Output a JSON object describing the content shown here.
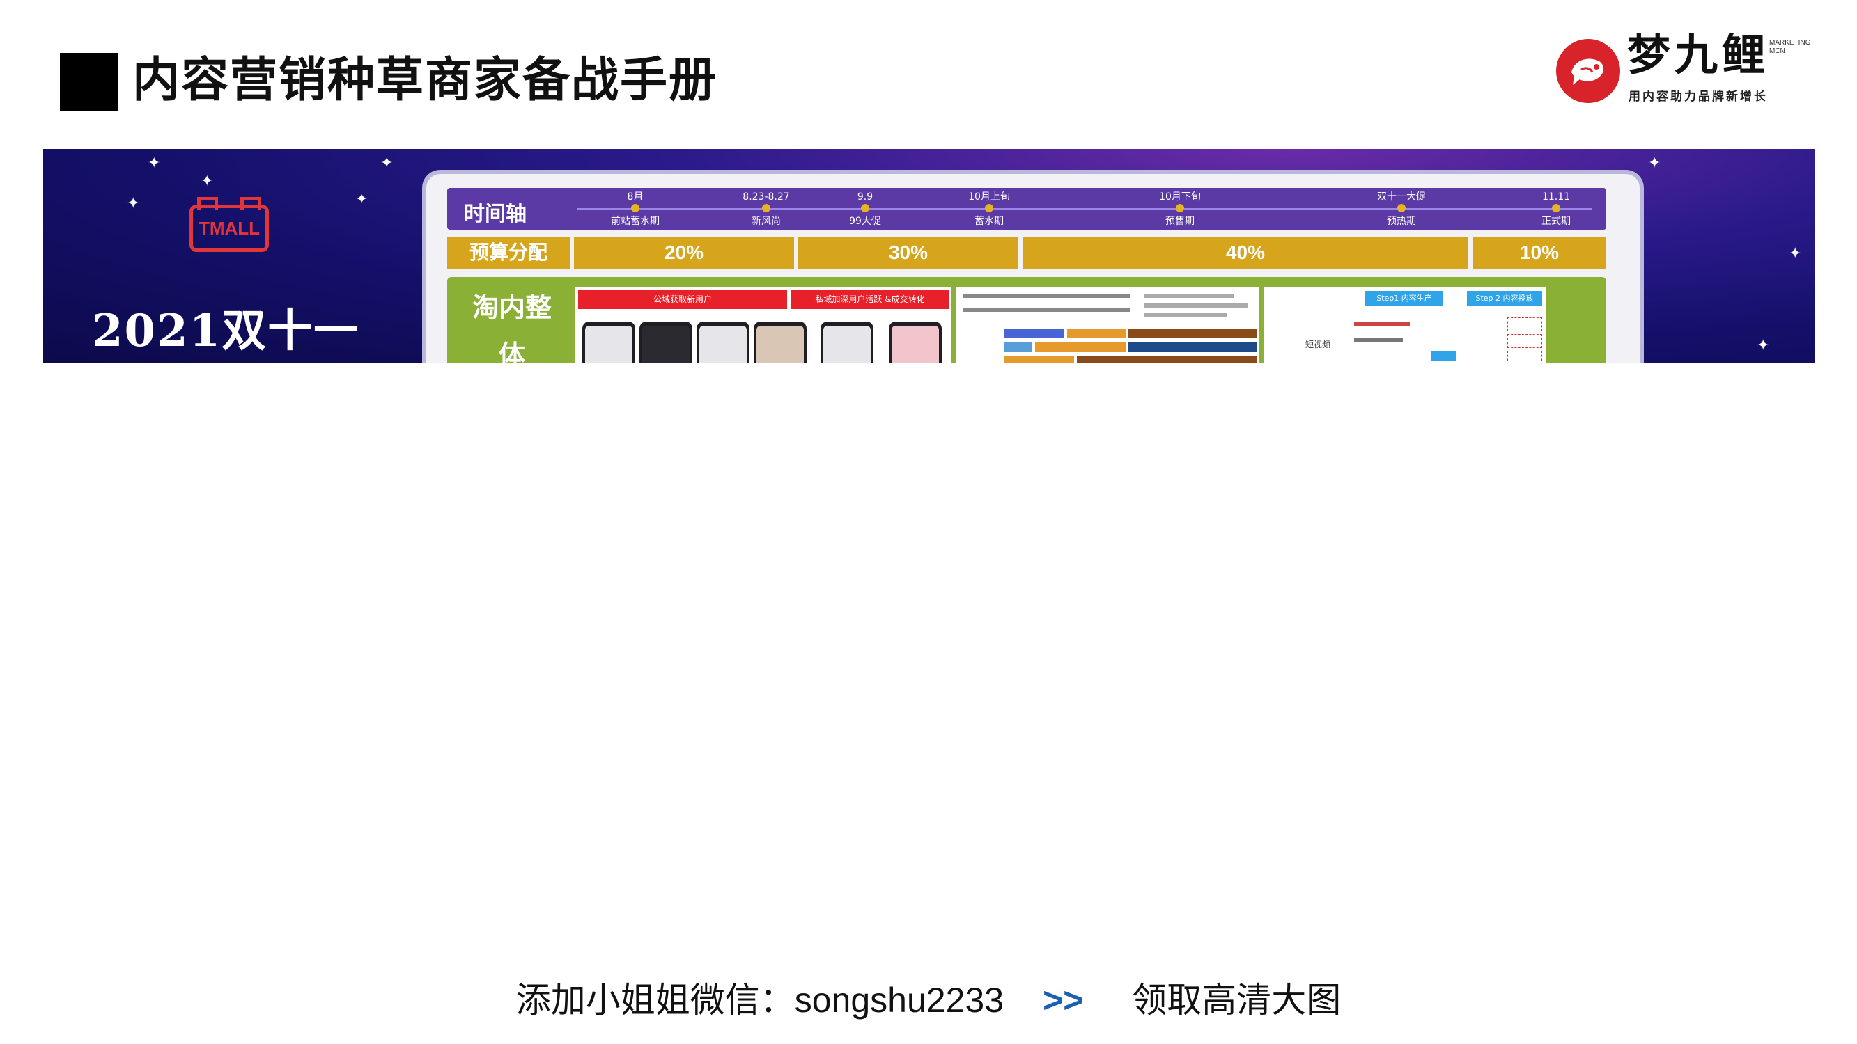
{
  "header": {
    "title": "内容营销种草商家备战手册"
  },
  "logo": {
    "name": "梦九鲤",
    "tagline": "用内容助力品牌新增长",
    "marketing_line1": "MARKETING",
    "marketing_line2": "MCN"
  },
  "banner": {
    "brand": "TMALL",
    "event": "2021双十一",
    "timeline": {
      "label": "时间轴",
      "milestones": [
        {
          "date": "8月",
          "phase": "前站蓄水期"
        },
        {
          "date": "8.23-8.27",
          "phase": "新风尚"
        },
        {
          "date": "9.9",
          "phase": "99大促"
        },
        {
          "date": "10月上旬",
          "phase": "蓄水期"
        },
        {
          "date": "10月下旬",
          "phase": "预售期"
        },
        {
          "date": "双十一大促",
          "phase": "预热期"
        },
        {
          "date": "11.11",
          "phase": "正式期"
        }
      ]
    },
    "budget": {
      "label": "预算分配",
      "segments": [
        "20%",
        "30%",
        "40%",
        "10%"
      ]
    },
    "content": {
      "label": "淘内整体",
      "thumb1_left": "公域获取新用户",
      "thumb1_right": "私域加深用户活跃 &成交转化",
      "thumb3_step1": "Step1 内容生产",
      "thumb3_step2": "Step 2 内容投放",
      "thumb3_short_video": "短视频"
    }
  },
  "footer": {
    "wechat_text": "添加小姐姐微信：songshu2233",
    "chevrons": ">>",
    "cta": "领取高清大图"
  }
}
